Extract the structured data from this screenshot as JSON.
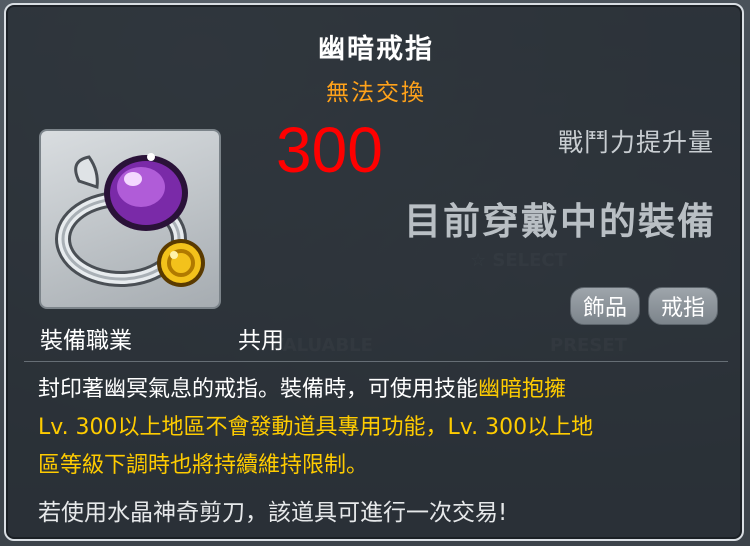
{
  "item": {
    "name": "幽暗戒指",
    "trade_status": "無法交換",
    "icon": "purple-gem-ring-icon"
  },
  "power": {
    "value": "300",
    "label": "戰鬥力提升量"
  },
  "equipped_status": "目前穿戴中的裝備",
  "tags": [
    "飾品",
    "戒指"
  ],
  "job": {
    "label": "裝備職業",
    "value": "共用"
  },
  "description": {
    "line1_prefix": "封印著幽冥氣息的戒指。裝備時，可使用技能",
    "line1_skill": "幽暗抱擁",
    "line2": "Lv. 300以上地區不會發動道具專用功能，Lv. 300以上地",
    "line3": "區等級下調時也將持續維持限制。"
  },
  "trade_note": "若使用水晶神奇剪刀，該道具可進行一次交易!",
  "colors": {
    "trade_status": "#ffa21a",
    "power_value": "#ff0000",
    "highlight": "#ffcc00"
  }
}
